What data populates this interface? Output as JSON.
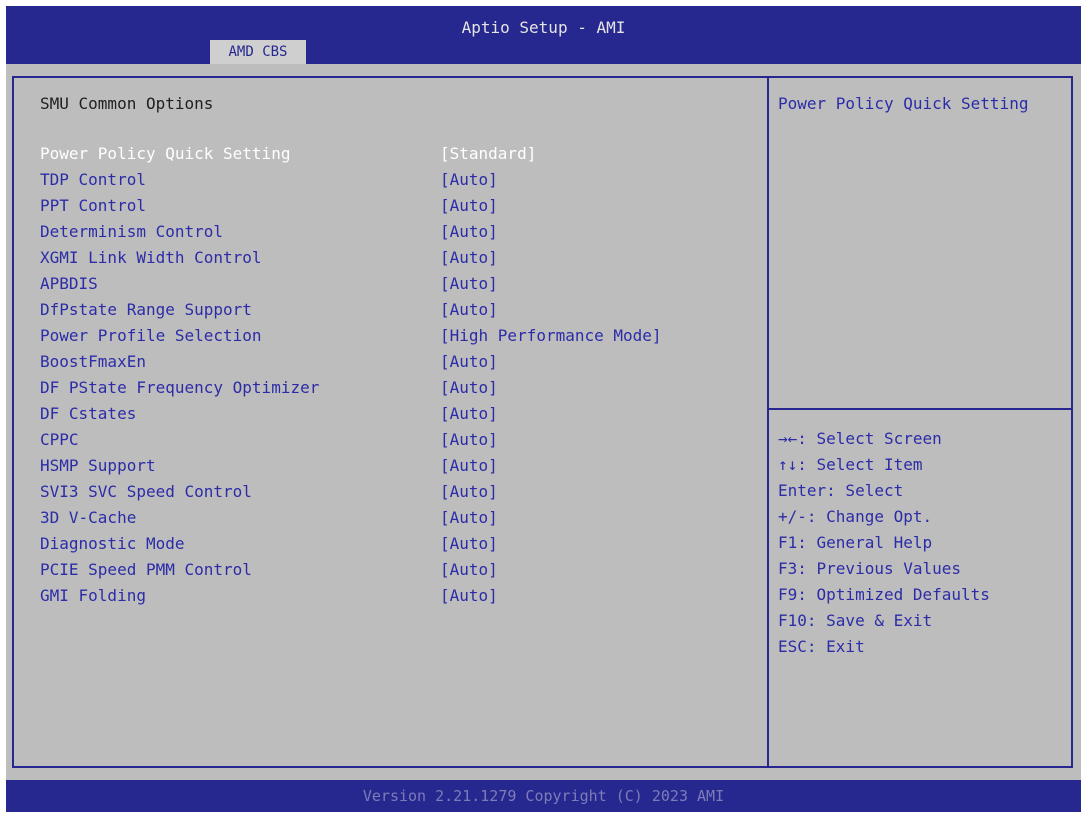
{
  "header": {
    "title": "Aptio Setup - AMI",
    "active_tab": "AMD CBS"
  },
  "section": {
    "title": "SMU Common Options"
  },
  "options": [
    {
      "label": "Power Policy Quick Setting",
      "value": "[Standard]",
      "selected": true
    },
    {
      "label": "TDP Control",
      "value": "[Auto]"
    },
    {
      "label": "PPT Control",
      "value": "[Auto]"
    },
    {
      "label": "Determinism Control",
      "value": "[Auto]"
    },
    {
      "label": "XGMI Link Width Control",
      "value": "[Auto]"
    },
    {
      "label": "APBDIS",
      "value": "[Auto]"
    },
    {
      "label": "DfPstate Range Support",
      "value": "[Auto]"
    },
    {
      "label": "Power Profile Selection",
      "value": "[High Performance Mode]"
    },
    {
      "label": "BoostFmaxEn",
      "value": "[Auto]"
    },
    {
      "label": "DF PState Frequency Optimizer",
      "value": "[Auto]"
    },
    {
      "label": "DF Cstates",
      "value": "[Auto]"
    },
    {
      "label": "CPPC",
      "value": "[Auto]"
    },
    {
      "label": "HSMP Support",
      "value": "[Auto]"
    },
    {
      "label": "SVI3 SVC Speed Control",
      "value": "[Auto]"
    },
    {
      "label": "3D V-Cache",
      "value": "[Auto]"
    },
    {
      "label": "Diagnostic Mode",
      "value": "[Auto]"
    },
    {
      "label": "PCIE Speed PMM Control",
      "value": "[Auto]"
    },
    {
      "label": "GMI Folding",
      "value": "[Auto]"
    }
  ],
  "help": {
    "text": "Power Policy Quick Setting"
  },
  "keys": [
    "→←: Select Screen",
    "↑↓: Select Item",
    "Enter: Select",
    "+/-: Change Opt.",
    "F1: General Help",
    "F3: Previous Values",
    "F9: Optimized Defaults",
    "F10: Save & Exit",
    "ESC: Exit"
  ],
  "footer": {
    "version": "Version 2.21.1279 Copyright (C) 2023 AMI"
  },
  "colors": {
    "bar": "#27288f",
    "background": "#bdbdbd",
    "option_text": "#2c2ca8",
    "selected_text": "#ffffff"
  }
}
